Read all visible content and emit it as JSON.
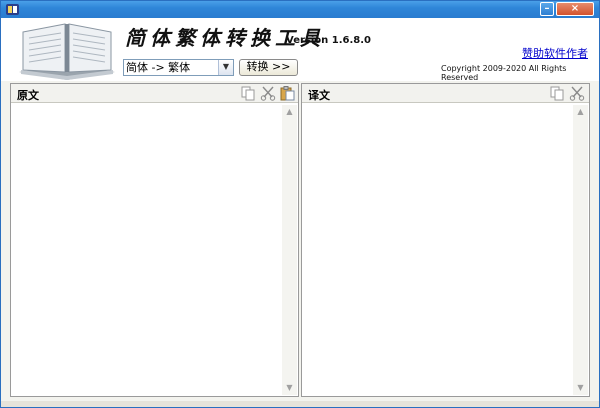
{
  "window": {
    "minimize": "–",
    "close": "×"
  },
  "header": {
    "app_title": "简体繁体转换工具",
    "version": "Version 1.6.8.0",
    "help_link": "赞助软件作者",
    "copyright": "Copyright 2009-2020 All Rights Reserved"
  },
  "controls": {
    "mode_selected": "简体 -> 繁体",
    "convert_label": "转换 >>"
  },
  "source_panel": {
    "title": "原文",
    "text": ""
  },
  "target_panel": {
    "title": "译文",
    "text": ""
  },
  "colors": {
    "titlebar": "#2f86d8",
    "link": "#0000cc",
    "panel_bg": "#ffffff"
  },
  "icons": [
    "app-icon",
    "book-logo",
    "copy-icon",
    "cut-icon",
    "paste-icon",
    "scroll-up-icon",
    "scroll-down-icon"
  ]
}
